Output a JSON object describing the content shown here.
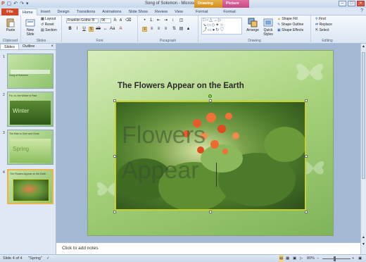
{
  "window": {
    "title": "Song of Solomon - Microsoft PowerPoint",
    "contextual_tabs": [
      "Drawing Tools",
      "Picture Tools"
    ]
  },
  "tabs": [
    "File",
    "Home",
    "Insert",
    "Design",
    "Transitions",
    "Animations",
    "Slide Show",
    "Review",
    "View",
    "Format",
    "Format"
  ],
  "ribbon": {
    "clipboard": {
      "paste": "Paste",
      "label": "Clipboard"
    },
    "slides": {
      "new_slide": "New Slide",
      "layout": "Layout",
      "reset": "Reset",
      "section": "Section",
      "label": "Slides"
    },
    "font": {
      "name": "Franklin Gothic B",
      "size": "96",
      "label": "Font"
    },
    "paragraph": {
      "label": "Paragraph"
    },
    "drawing": {
      "arrange": "Arrange",
      "quick_styles": "Quick Styles",
      "shape_fill": "Shape Fill",
      "shape_outline": "Shape Outline",
      "shape_effects": "Shape Effects",
      "label": "Drawing"
    },
    "editing": {
      "find": "Find",
      "replace": "Replace",
      "select": "Select",
      "label": "Editing"
    }
  },
  "pane_tabs": [
    "Slides",
    "Outline"
  ],
  "thumbnails": [
    {
      "num": "1",
      "text": "Song of Solomon",
      "big": ""
    },
    {
      "num": "2",
      "text": "For, lo, the Winter is Past",
      "big": "Winter"
    },
    {
      "num": "3",
      "text": "The Rain is Over and Gone",
      "big": "Spring"
    },
    {
      "num": "4",
      "text": "The Flowers Appear on the Earth",
      "big": ""
    }
  ],
  "slide": {
    "title": "The Flowers Appear on the Earth",
    "overlay_line1": "Flowers",
    "overlay_line2": "Appear"
  },
  "notes": {
    "placeholder": "Click to add notes"
  },
  "status": {
    "slide_info": "Slide 4 of 4",
    "theme": "\"Spring\"",
    "zoom": "80%"
  }
}
